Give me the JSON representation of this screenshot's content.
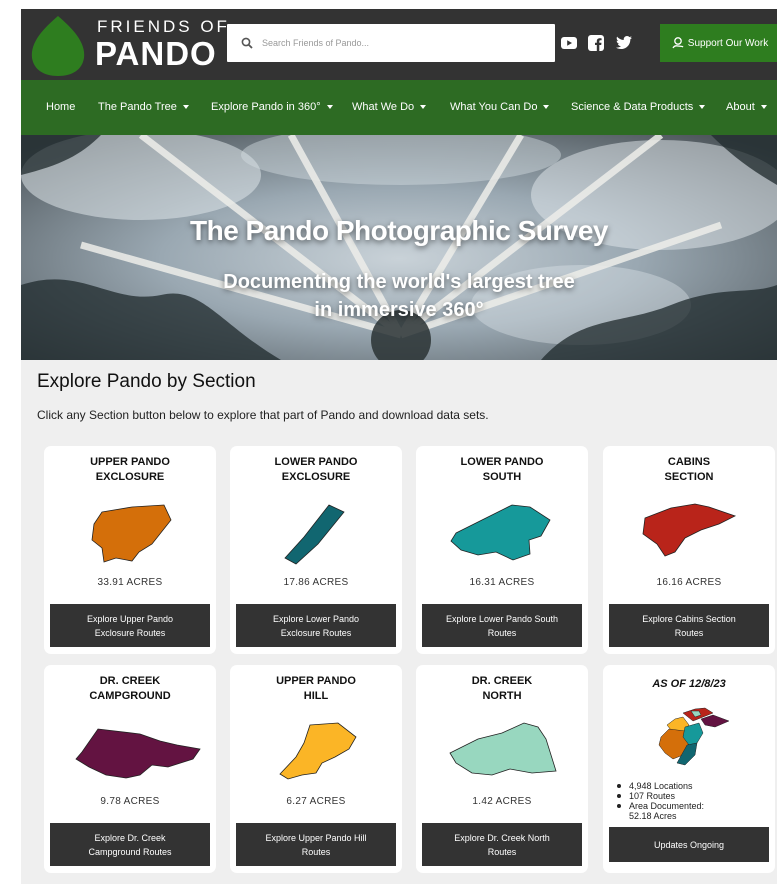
{
  "header": {
    "logo_top": "FRIENDS OF",
    "logo_bottom": "PANDO",
    "search_placeholder": "Search Friends of Pando...",
    "social_icons": [
      "youtube-icon",
      "facebook-icon",
      "twitter-icon"
    ],
    "support_label": "Support Our Work",
    "brand_color": "#2d6b23"
  },
  "nav": {
    "items": [
      {
        "label": "Home",
        "has_dropdown": false
      },
      {
        "label": "The Pando Tree",
        "has_dropdown": true
      },
      {
        "label": "Explore Pando in 360°",
        "has_dropdown": true
      },
      {
        "label": "What We Do",
        "has_dropdown": true
      },
      {
        "label": "What You Can Do",
        "has_dropdown": true
      },
      {
        "label": "Science & Data Products",
        "has_dropdown": true
      },
      {
        "label": "About",
        "has_dropdown": true
      }
    ]
  },
  "hero": {
    "title": "The Pando Photographic Survey",
    "subtitle_line1": "Documenting the world's largest tree",
    "subtitle_line2": "in immersive 360°"
  },
  "section": {
    "title": "Explore Pando by Section",
    "description": "Click any Section button below to explore that part of Pando and download data sets."
  },
  "cards": [
    {
      "title1": "UPPER PANDO",
      "title2": "EXCLOSURE",
      "acres": "33.91 ACRES",
      "button1": "Explore Upper Pando",
      "button2": "Exclosure Routes",
      "color": "#d46f0a"
    },
    {
      "title1": "LOWER PANDO",
      "title2": "EXCLOSURE",
      "acres": "17.86 ACRES",
      "button1": "Explore Lower Pando",
      "button2": "Exclosure Routes",
      "color": "#116670"
    },
    {
      "title1": "LOWER PANDO",
      "title2": "SOUTH",
      "acres": "16.31 ACRES",
      "button1": "Explore Lower Pando South",
      "button2": "Routes",
      "color": "#16999a"
    },
    {
      "title1": "CABINS",
      "title2": "SECTION",
      "acres": "16.16 ACRES",
      "button1": "Explore Cabins Section",
      "button2": "Routes",
      "color": "#b9241a"
    },
    {
      "title1": "DR. CREEK",
      "title2": "CAMPGROUND",
      "acres": "9.78 ACRES",
      "button1": "Explore Dr. Creek",
      "button2": "Campground Routes",
      "color": "#631341"
    },
    {
      "title1": "UPPER PANDO",
      "title2": "HILL",
      "acres": "6.27 ACRES",
      "button1": "Explore Upper Pando Hill",
      "button2": "Routes",
      "color": "#fbb526"
    },
    {
      "title1": "DR. CREEK",
      "title2": "NORTH",
      "acres": "1.42 ACRES",
      "button1": "Explore Dr. Creek North",
      "button2": "Routes",
      "color": "#98d7bf"
    }
  ],
  "summary_card": {
    "title": "AS OF 12/8/23",
    "stats": [
      "4,948 Locations",
      "107 Routes",
      "Area Documented:",
      "52.18 Acres"
    ],
    "button": "Updates Ongoing"
  }
}
